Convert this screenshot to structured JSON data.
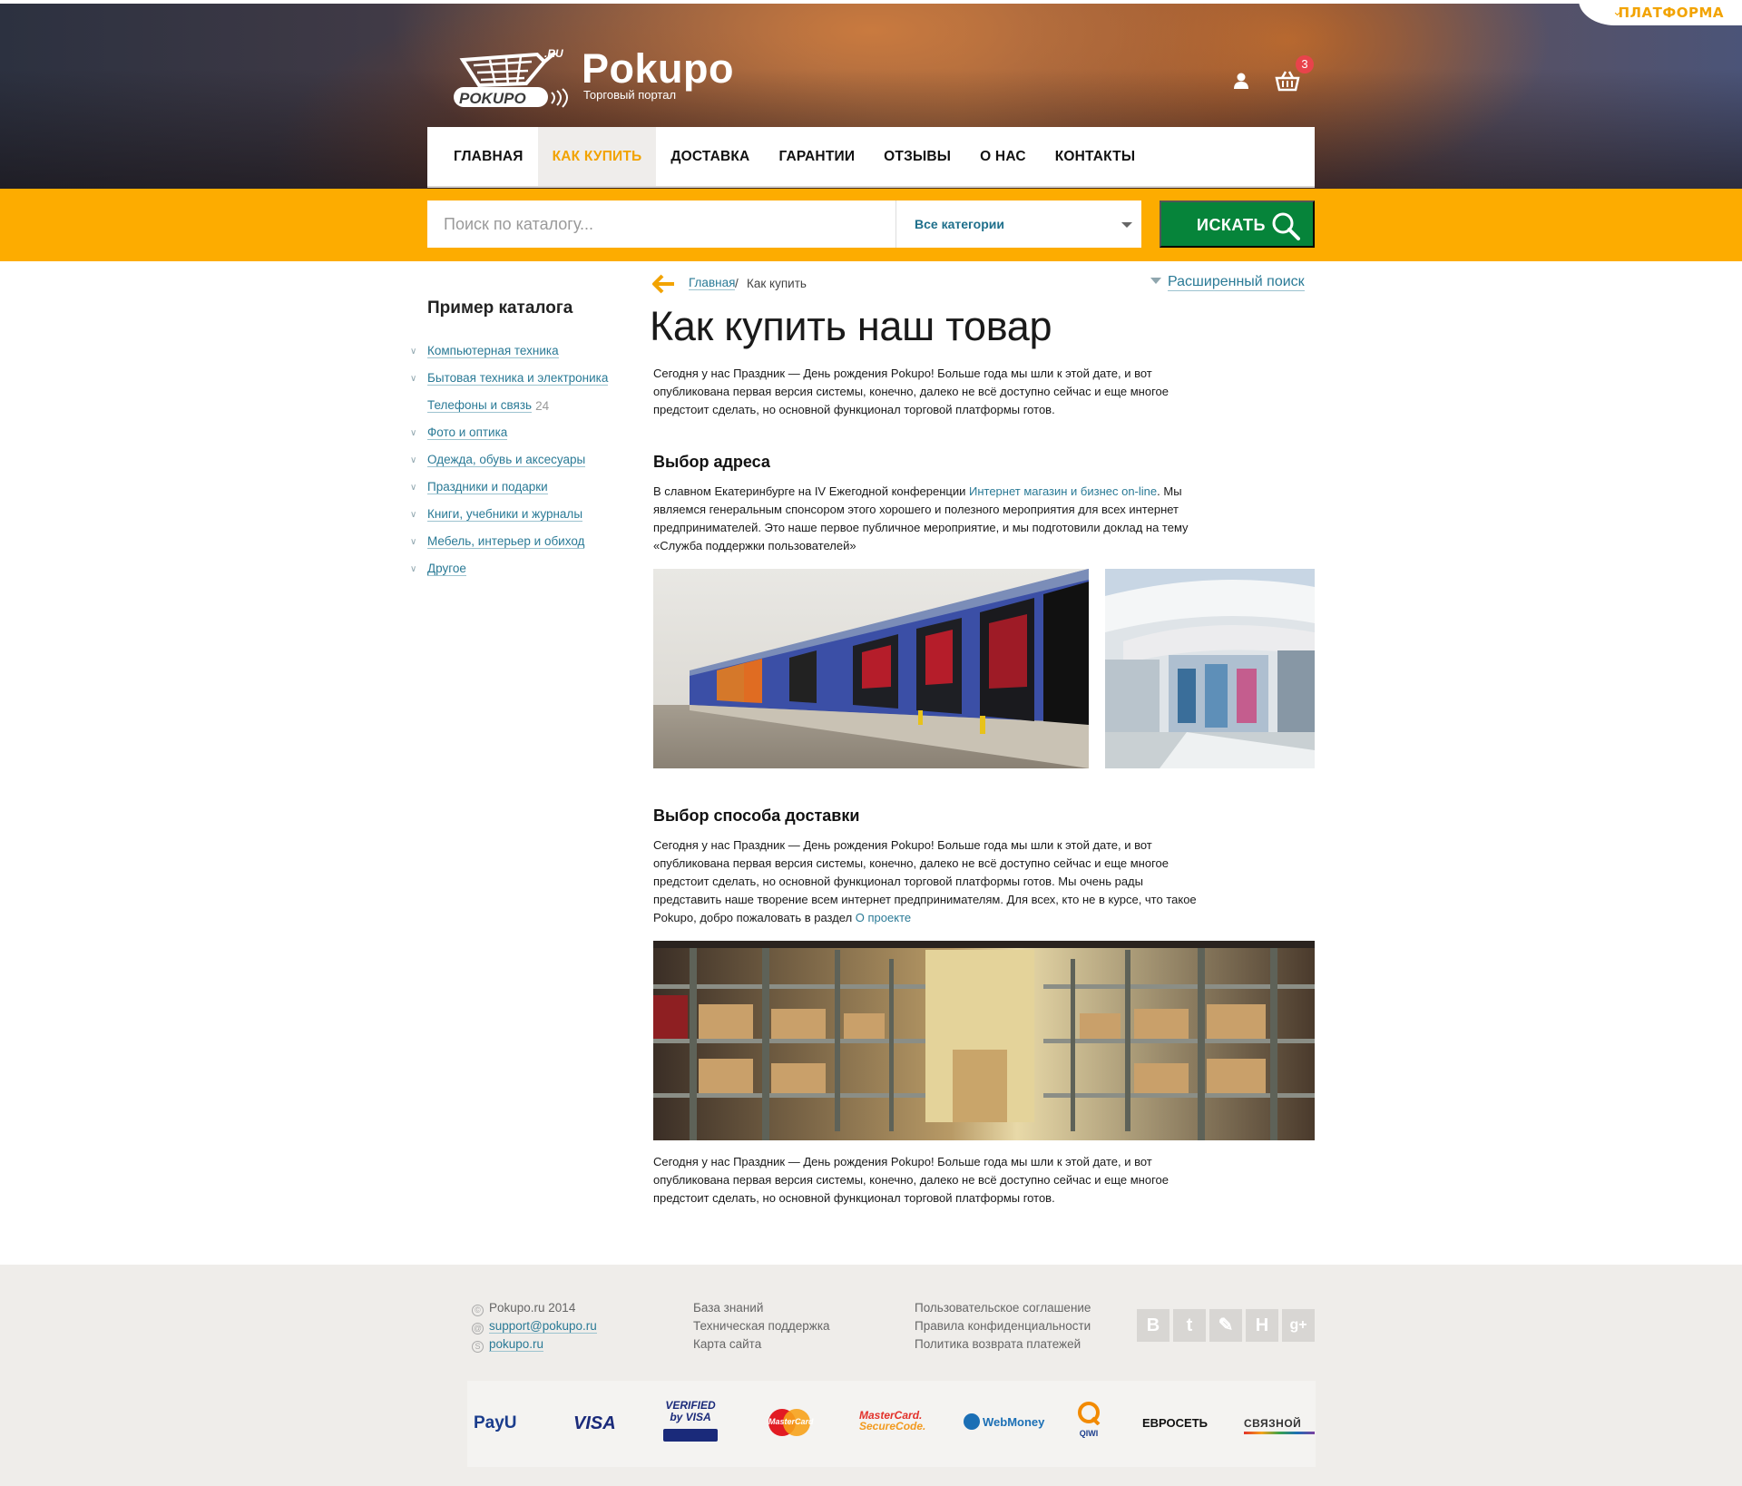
{
  "header": {
    "platform_label": "ПЛАТФОРМА",
    "logo_mark_text": "POKUPO",
    "logo_ru": ".RU",
    "brand_name": "Pokupo",
    "tagline": "Торговый портал",
    "cart_count": "3"
  },
  "nav": {
    "items": [
      {
        "label": "ГЛАВНАЯ",
        "active": false
      },
      {
        "label": "КАК КУПИТЬ",
        "active": true
      },
      {
        "label": "ДОСТАВКА",
        "active": false
      },
      {
        "label": "ГАРАНТИИ",
        "active": false
      },
      {
        "label": "ОТЗЫВЫ",
        "active": false
      },
      {
        "label": "О НАС",
        "active": false
      },
      {
        "label": "КОНТАКТЫ",
        "active": false
      }
    ]
  },
  "search": {
    "placeholder": "Поиск по каталогу...",
    "category_value": "Все категории",
    "button_label": "ИСКАТЬ"
  },
  "sidebar": {
    "title": "Пример каталога",
    "categories": [
      {
        "label": "Компьютерная техника",
        "expandable": true
      },
      {
        "label": "Бытовая техника и электроника",
        "expandable": true
      },
      {
        "label": "Телефоны и связь",
        "count": "24",
        "expandable": false
      },
      {
        "label": "Фото и оптика",
        "expandable": true
      },
      {
        "label": "Одежда, обувь и аксесуары",
        "expandable": true
      },
      {
        "label": "Праздники и подарки",
        "expandable": true
      },
      {
        "label": "Книги, учебники и журналы",
        "expandable": true
      },
      {
        "label": "Мебель, интерьер и обиход",
        "expandable": true
      },
      {
        "label": "Другое",
        "expandable": true
      }
    ]
  },
  "breadcrumb": {
    "home": "Главная",
    "separator": "/",
    "current": "Как купить"
  },
  "advanced_search": "Расширенный поиск",
  "article": {
    "title": "Как купить наш товар",
    "intro": "Сегодня у нас Праздник — День рождения Pokupo! Больше года мы шли к этой дате, и вот опубликована первая версия системы, конечно, далеко не всё доступно сейчас и еще многое предстоит сделать, но основной функционал торговой платформы готов.",
    "section1_title": "Выбор адреса",
    "section1_text_a": "В славном Екатеринбурге на IV Ежегодной конференции ",
    "section1_link": "Интернет магазин и бизнес on-line",
    "section1_text_b": ". Мы являемся генеральным спонсором этого хорошего и полезного мероприятия для всех интернет предпринимателей. Это наше первое публичное мероприятие, и мы подготовили доклад на тему «Служба поддержки пользователей»",
    "section2_title": "Выбор способа доставки",
    "section2_text_a": "Сегодня у нас Праздник — День рождения Pokupo! Больше года мы шли к этой дате, и вот опубликована первая версия системы, конечно, далеко не всё доступно сейчас и еще многое предстоит сделать, но основной функционал торговой платформы готов. Мы очень рады представить наше творение всем интернет предпринимателям. Для всех, кто не в курсе, что такое Pokupo, добро пожаловать в раздел ",
    "section2_link": "О проекте",
    "outro": "Сегодня у нас Праздник — День рождения Pokupo! Больше года мы шли к этой дате, и вот опубликована первая версия системы, конечно, далеко не всё доступно сейчас и еще многое предстоит сделать, но основной функционал торговой платформы готов."
  },
  "footer": {
    "copyright": "Pokupo.ru 2014",
    "email": "support@pokupo.ru",
    "skype": "pokupo.ru",
    "col2": [
      "База знаний",
      "Техническая поддержка",
      "Карта сайта"
    ],
    "col3": [
      "Пользовательское соглашение",
      "Правила конфиденциальности",
      "Политика возврата платежей"
    ],
    "social": [
      "В",
      "t",
      "✎",
      "Н",
      "g+"
    ],
    "payments": {
      "payu": "PayU",
      "visa": "VISA",
      "verified_top": "VERIFIED",
      "verified_bottom": "by VISA",
      "mastercard": "MasterCard",
      "securecode_top": "MasterCard.",
      "securecode_bottom": "SecureCode.",
      "webmoney": "WebMoney",
      "qiwi": "QIWI",
      "evroset": "ЕВРОСЕТЬ",
      "svyaznoy": "СВЯЗНОЙ"
    }
  },
  "colors": {
    "accent_orange": "#fdac00",
    "search_green": "#06843a",
    "link_blue": "#2a7a96",
    "badge_red": "#e8434b"
  }
}
